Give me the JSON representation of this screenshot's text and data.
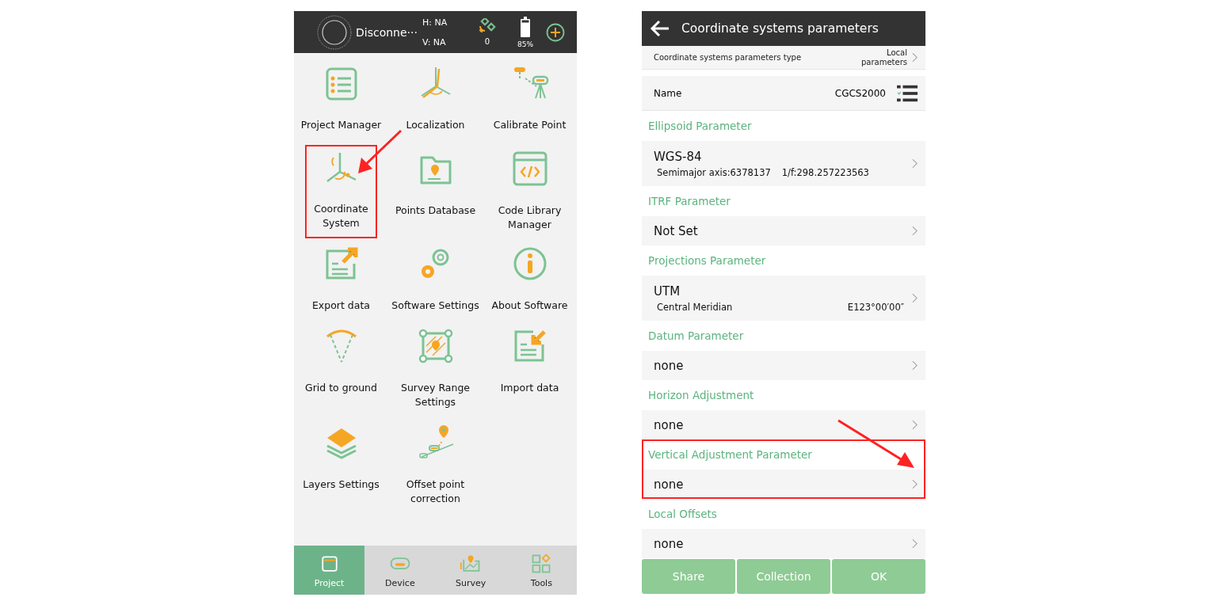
{
  "home": {
    "status_bar": {
      "connection": "Disconne···",
      "h": "H: NA",
      "v": "V: NA",
      "satellites": "0",
      "battery": "85%"
    },
    "tiles": [
      {
        "label": "Project Manager",
        "highlighted": false
      },
      {
        "label": "Localization",
        "highlighted": false
      },
      {
        "label": "Calibrate Point",
        "highlighted": false
      },
      {
        "label": "Coordinate System",
        "highlighted": true
      },
      {
        "label": "Points Database",
        "highlighted": false
      },
      {
        "label": "Code Library Manager",
        "highlighted": false
      },
      {
        "label": "Export data",
        "highlighted": false
      },
      {
        "label": "Software Settings",
        "highlighted": false
      },
      {
        "label": "About Software",
        "highlighted": false
      },
      {
        "label": "Grid to ground",
        "highlighted": false
      },
      {
        "label": "Survey Range Settings",
        "highlighted": false
      },
      {
        "label": "Import data",
        "highlighted": false
      },
      {
        "label": "Layers Settings",
        "highlighted": false
      },
      {
        "label": "Offset point correction",
        "highlighted": false
      }
    ],
    "tabs": [
      {
        "label": "Project",
        "selected": true
      },
      {
        "label": "Device",
        "selected": false
      },
      {
        "label": "Survey",
        "selected": false
      },
      {
        "label": "Tools",
        "selected": false
      }
    ]
  },
  "params": {
    "title": "Coordinate systems parameters",
    "type_row": {
      "label": "Coordinate systems parameters type",
      "value": "Local parameters"
    },
    "name_row": {
      "label": "Name",
      "value": "CGCS2000"
    },
    "sections": [
      {
        "title": "Ellipsoid Parameter",
        "value": "WGS-84",
        "kind": "inline",
        "details": [
          "Semimajor axis:6378137",
          "1/f:298.257223563"
        ],
        "highlighted": false
      },
      {
        "title": "ITRF Parameter",
        "value": "Not Set",
        "kind": "plain",
        "highlighted": false
      },
      {
        "title": "Projections Parameter",
        "value": "UTM",
        "kind": "spread",
        "details": [
          "Central Meridian",
          "E123°00′00″"
        ],
        "highlighted": false
      },
      {
        "title": "Datum Parameter",
        "value": "none",
        "kind": "plain",
        "highlighted": false
      },
      {
        "title": "Horizon Adjustment",
        "value": "none",
        "kind": "plain",
        "highlighted": false
      },
      {
        "title": "Vertical Adjustment Parameter",
        "value": "none",
        "kind": "plain",
        "highlighted": true
      },
      {
        "title": "Local Offsets",
        "value": "none",
        "kind": "plain",
        "highlighted": false
      }
    ],
    "buttons": [
      "Share",
      "Collection",
      "OK"
    ]
  }
}
